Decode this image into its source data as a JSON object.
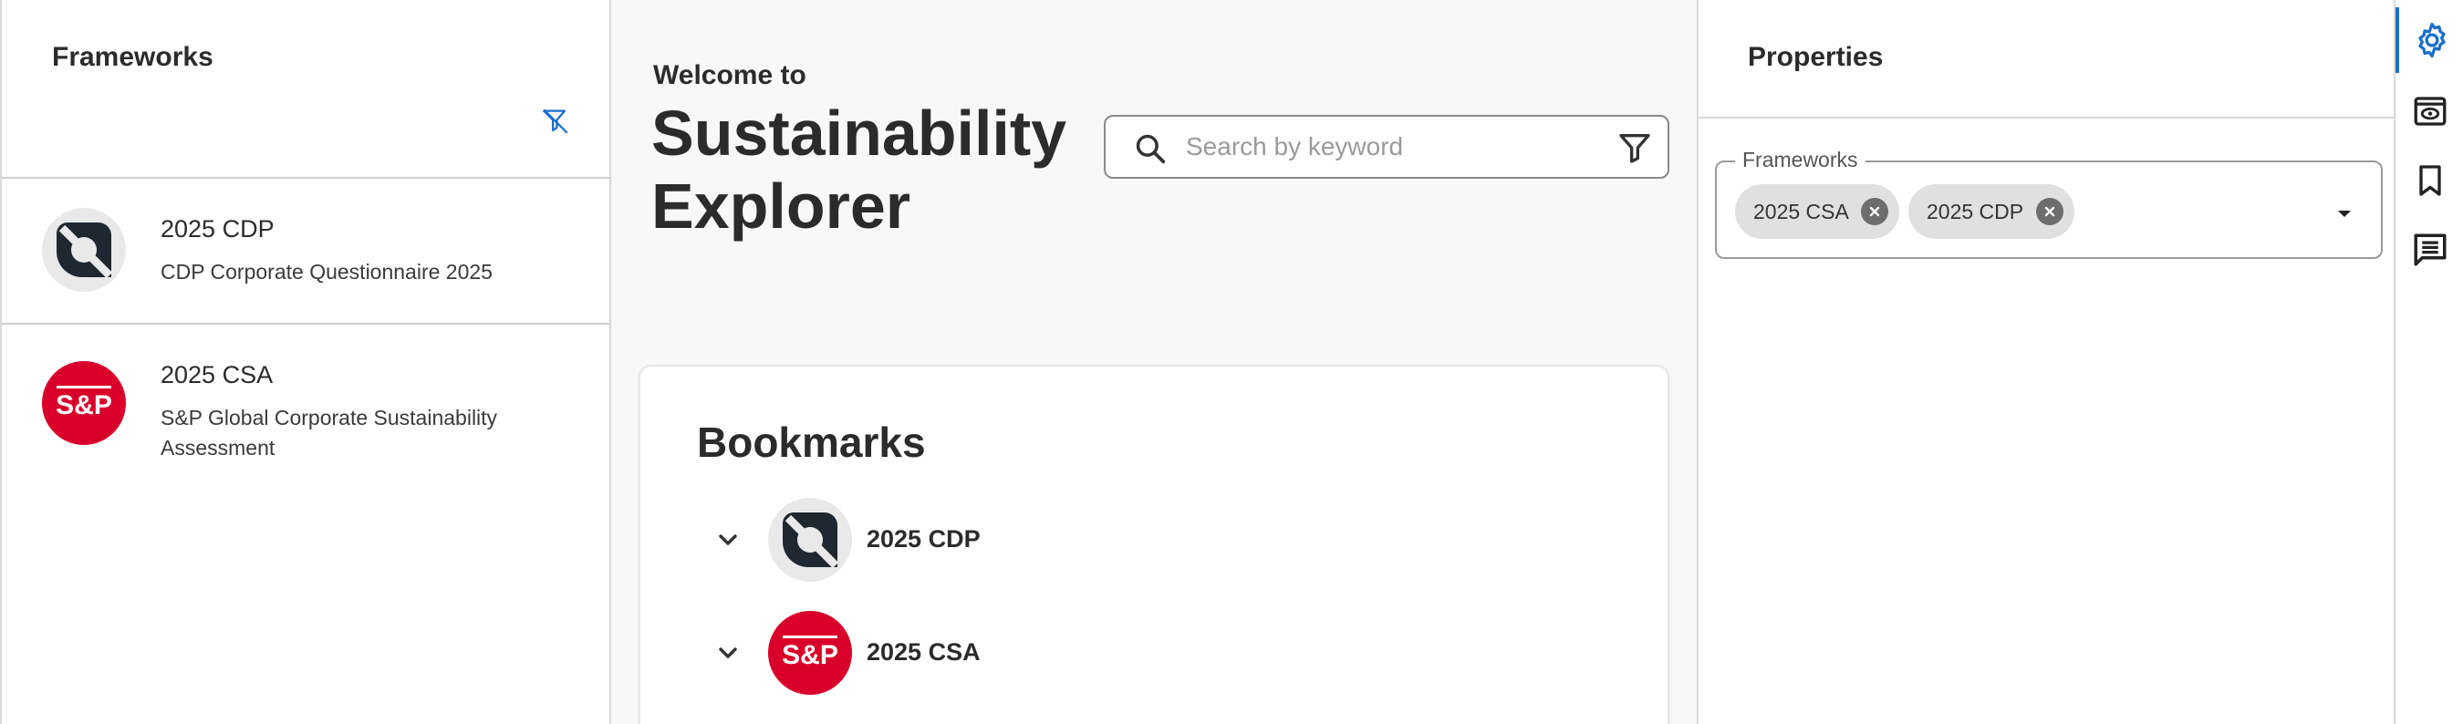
{
  "left_panel": {
    "title": "Frameworks",
    "items": [
      {
        "name": "2025 CDP",
        "description": "CDP Corporate Questionnaire 2025",
        "logo": "cdp-logo"
      },
      {
        "name": "2025 CSA",
        "description": "S&P Global Corporate Sustainability Assessment",
        "logo": "sp-logo"
      }
    ]
  },
  "center": {
    "welcome": "Welcome to",
    "title_line1": "Sustainability",
    "title_line2": "Explorer",
    "search": {
      "placeholder": "Search by keyword",
      "value": ""
    },
    "bookmarks": {
      "title": "Bookmarks",
      "items": [
        {
          "label": "2025 CDP",
          "logo": "cdp-logo"
        },
        {
          "label": "2025 CSA",
          "logo": "sp-logo"
        }
      ]
    }
  },
  "right_panel": {
    "title": "Properties",
    "frameworks_field": {
      "label": "Frameworks",
      "chips": [
        "2025 CSA",
        "2025 CDP"
      ]
    }
  },
  "logos": {
    "sp_text": "S&P"
  },
  "toolbar": {
    "items": [
      "gear-icon",
      "preview-icon",
      "bookmark-icon",
      "comment-icon"
    ],
    "active": "gear-icon"
  },
  "colors": {
    "accent": "#1a6fc9",
    "sp_red": "#d8002a",
    "cdp_dark": "#1f2830",
    "chip_bg": "#e0e0e0"
  }
}
